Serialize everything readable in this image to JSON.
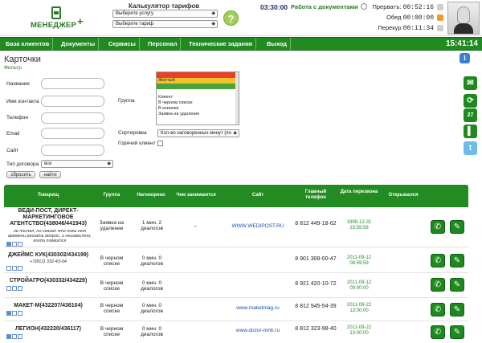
{
  "header": {
    "logo_text": "МЕНЕДЖЕР",
    "logo_plus": "+",
    "calc_title": "Калькулятор тарифов",
    "service_select": "Выберите услугу",
    "tariff_select": "Выберите тариф",
    "help_label": "?",
    "work_timer": "03:30:00",
    "work_status": "Работа с документами",
    "interrupt_label": "Прерватъ:",
    "interrupt_time": "00:52:16",
    "lunch_label": "Обед",
    "lunch_time": "00:00:00",
    "break_label": "Перекур",
    "break_time": "00:11:34"
  },
  "nav": {
    "items": [
      "База клиентов",
      "Документы",
      "Сервисы",
      "Персонал",
      "Технические задания",
      "Выход"
    ],
    "clock": "15:41:14"
  },
  "page": {
    "title": "Карточки",
    "filter_link": "Фильтр"
  },
  "filter": {
    "name_label": "Название",
    "contact_label": "Имя контакта",
    "phone_label": "Телефон",
    "email_label": "Email",
    "site_label": "Сайт",
    "group_label": "Группа",
    "group_options": [
      "Красный",
      "Желтый",
      "Зеленый",
      "",
      "Клиент",
      "В черном списке",
      "В копилке",
      "Заявка на удаление"
    ],
    "sort_label": "Сортировка",
    "sort_value": "Кол-во наговоренных минут (по",
    "hot_label": "Горячий клиент",
    "contract_label": "Тип договора",
    "contract_value": "все",
    "reset_button": "сбросить",
    "find_button": "найти"
  },
  "table": {
    "headers": {
      "company": "Товарищ",
      "group": "Группа",
      "dialed": "Наговорено",
      "doing": "Чем занимаются",
      "site": "Сайт",
      "phone": "Главный телефон",
      "date": "Дата перезвона",
      "opened": "Открывался"
    },
    "rows": [
      {
        "name": "ВЕДИ-ПОСТ, ДИРЕКТ-МАРКЕТИНГОВОЕ АГЕНТСТВО(438046/441943)",
        "note": "не послал, но сказал что пока нет времени решать вопрос, и неизвестно, когда появится",
        "group": "Заявка на удаление",
        "dialed": "1 мин. 2 диалогов",
        "doing": "←",
        "site": "WWW.WEDIPOST.RU",
        "phone": "8 812 449-18-62",
        "date": "1999-12-31 23:59:58"
      },
      {
        "name": "ДЖЕЙМС КУК(430302/434199)",
        "phone2": "+7(812) 332-43-04",
        "group": "В черном списке",
        "dialed": "0 мин. 0 диалогов",
        "doing": "",
        "site": "",
        "phone": "8 901 308-00-47",
        "date": "2011-09-12 08:59:59"
      },
      {
        "name": "СТРОЙАГРО(430332/434229)",
        "group": "В черном списке",
        "dialed": "0 мин. 0 диалогов",
        "doing": "",
        "site": "",
        "phone": "8 921 420-10-72",
        "date": "2011-09-12 09:00:00"
      },
      {
        "name": "МАКЕТ-М(432207/436104)",
        "group": "В черном списке",
        "dialed": "0 мин. 0 диалогов",
        "doing": "",
        "site": "www.maketmag.ru",
        "phone": "8 812 945-54-39",
        "date": "2011-09-22 13:00:00"
      },
      {
        "name": "ЛЕГИОН(432220/436117)",
        "group": "В черном списке",
        "dialed": "0 мин. 0 диалогов",
        "doing": "",
        "site": "www.dozor-mnb.ru",
        "phone": "8 812 323-98-40",
        "date": "2011-09-22 13:00:00"
      }
    ]
  },
  "colors": {
    "nav_green": "#218a21",
    "accent_green": "#2a7a2a",
    "link_blue": "#1a4ea8",
    "group_red": "#e8402a",
    "group_yellow": "#f3c12a",
    "group_green": "#4aa23a"
  },
  "icons": [
    "help-icon",
    "clock-icon",
    "phone-icon",
    "pencil-icon",
    "mail-icon",
    "refresh-icon",
    "calendar-icon",
    "notebook-icon",
    "twitter-icon",
    "info-icon"
  ]
}
